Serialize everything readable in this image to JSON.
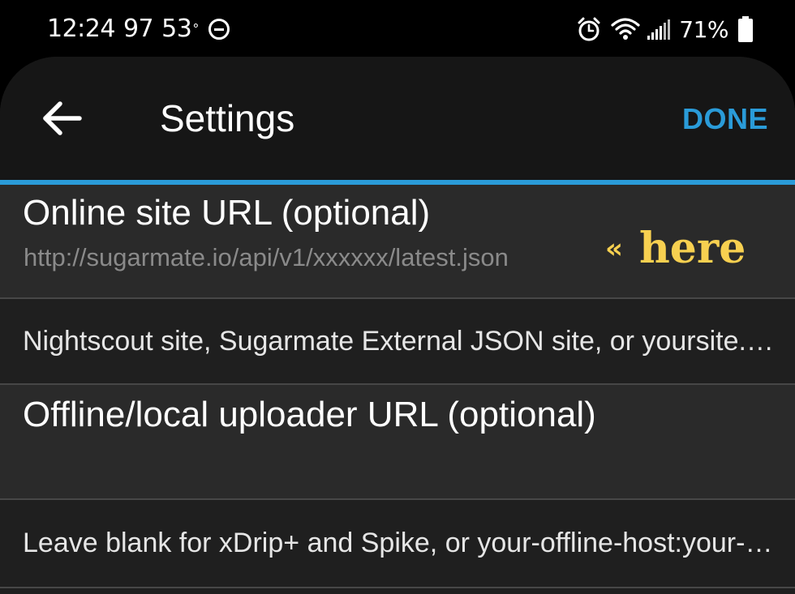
{
  "status_bar": {
    "time": "12:24",
    "notif_number": "97",
    "temperature": "53",
    "degree_symbol": "°",
    "battery_percent": "71%",
    "icons": [
      "do-not-disturb-icon",
      "alarm-icon",
      "wifi-icon",
      "signal-icon",
      "battery-icon"
    ]
  },
  "header": {
    "title": "Settings",
    "done_label": "DONE"
  },
  "settings": {
    "online": {
      "title": "Online site URL (optional)",
      "value": "http://sugarmate.io/api/v1/xxxxxx/latest.json",
      "description": "Nightscout site, Sugarmate External JSON site, or yoursite.com"
    },
    "offline": {
      "title": "Offline/local uploader URL (optional)",
      "value": "",
      "description": "Leave blank for xDrip+ and Spike, or your-offline-host:your-port"
    }
  },
  "annotation": {
    "arrow": "«",
    "text": "here"
  },
  "colors": {
    "accent": "#2a9bd8",
    "annotation": "#f7d050",
    "background": "#1f1f1f",
    "row_background": "#2a2a2a",
    "header_background": "#161616"
  }
}
